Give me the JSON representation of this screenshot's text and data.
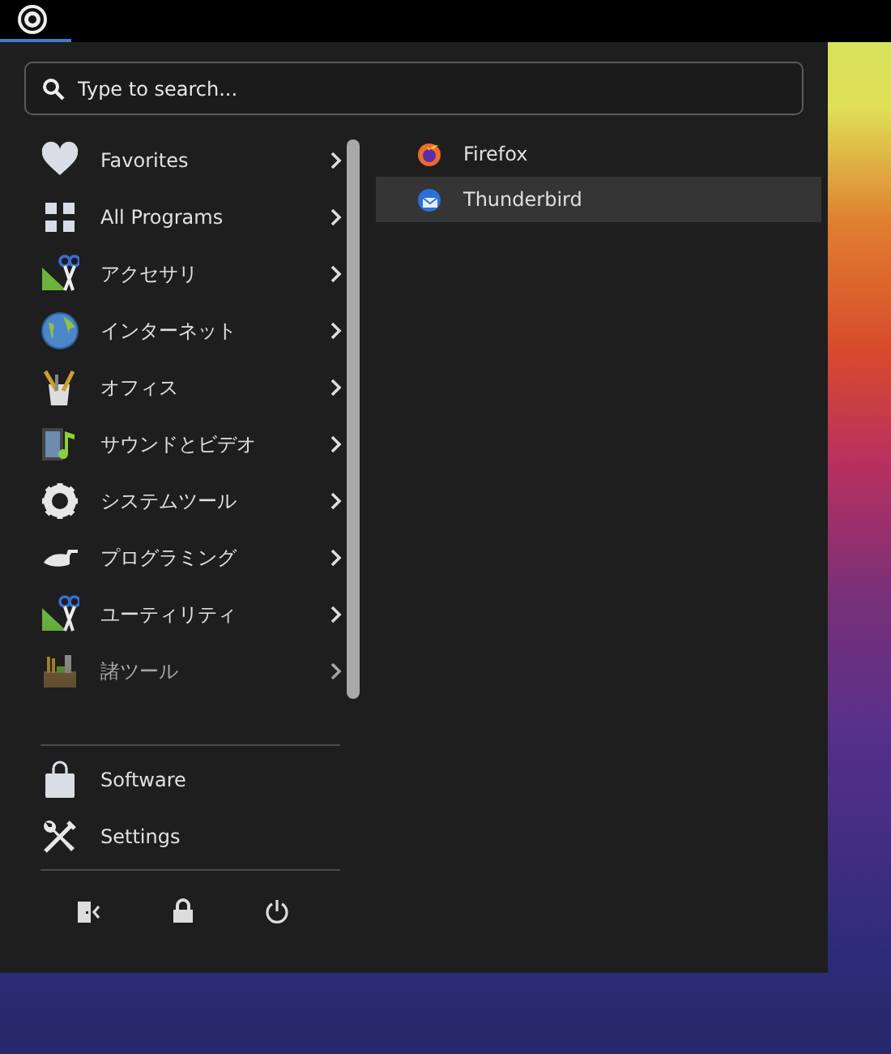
{
  "search": {
    "placeholder": "Type to search..."
  },
  "categories": [
    {
      "label": "Favorites"
    },
    {
      "label": "All Programs"
    },
    {
      "label": "アクセサリ"
    },
    {
      "label": "インターネット"
    },
    {
      "label": "オフィス"
    },
    {
      "label": "サウンドとビデオ"
    },
    {
      "label": "システムツール"
    },
    {
      "label": "プログラミング"
    },
    {
      "label": "ユーティリティ"
    },
    {
      "label": "諸ツール"
    }
  ],
  "applications": [
    {
      "label": "Firefox",
      "selected": false
    },
    {
      "label": "Thunderbird",
      "selected": true
    }
  ],
  "shortcuts": [
    {
      "label": "Software"
    },
    {
      "label": "Settings"
    }
  ]
}
